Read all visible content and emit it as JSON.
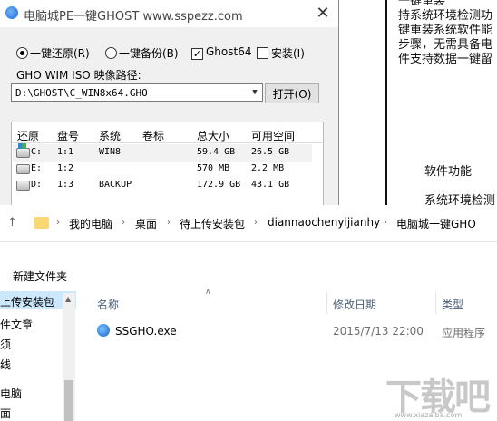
{
  "article": {
    "lines": [
      "一键重装",
      "持系统环境检测功",
      "键重装系统软件能",
      "步骤，无需具备电",
      "件支持数据一键留"
    ],
    "heading": "软件功能",
    "sub": "系统环境检测"
  },
  "ghost_window": {
    "title": "电脑城PE一键GHOST  www.sspezz.com",
    "close": "✕",
    "options": [
      {
        "label": "一键还原(R)",
        "type": "radio",
        "checked": true
      },
      {
        "label": "一键备份(B)",
        "type": "radio",
        "checked": false
      },
      {
        "label": "Ghost64",
        "type": "checkbox",
        "checked": true
      },
      {
        "label": "安装(I)",
        "type": "checkbox",
        "checked": false
      }
    ],
    "path_label": "GHO WIM ISO 映像路径:",
    "path_value": "D:\\GHOST\\C_WIN8x64.GHO",
    "open_button": "打开(O)",
    "columns": [
      "还原",
      "盘号",
      "系统",
      "卷标",
      "总大小",
      "可用空间"
    ],
    "rows": [
      {
        "drive": "C:",
        "disk": "1:1",
        "system": "WIN8",
        "label": "",
        "total": "59.4 GB",
        "free": "26.5 GB"
      },
      {
        "drive": "E:",
        "disk": "1:2",
        "system": "",
        "label": "",
        "total": "570 MB",
        "free": "2.2 MB"
      },
      {
        "drive": "D:",
        "disk": "1:3",
        "system": "BACKUP",
        "label": "",
        "total": "172.9 GB",
        "free": "43.1 GB"
      }
    ]
  },
  "explorer": {
    "breadcrumbs": [
      "我的电脑",
      "桌面",
      "待上传安装包",
      "diannaochenyijianhy",
      "电脑城一键GHO"
    ],
    "new_folder": "新建文件夹",
    "nav_items": [
      "上传安装包",
      "件文章",
      "须",
      "线",
      "电脑",
      "面"
    ],
    "columns": {
      "name": "名称",
      "date": "修改日期",
      "type": "类型"
    },
    "files": [
      {
        "name": "SSGHO.exe",
        "date": "2015/7/13 22:00",
        "type": "应用程序"
      }
    ]
  },
  "watermark": {
    "big": "下载吧",
    "small": "www.xiazaiba.com"
  }
}
